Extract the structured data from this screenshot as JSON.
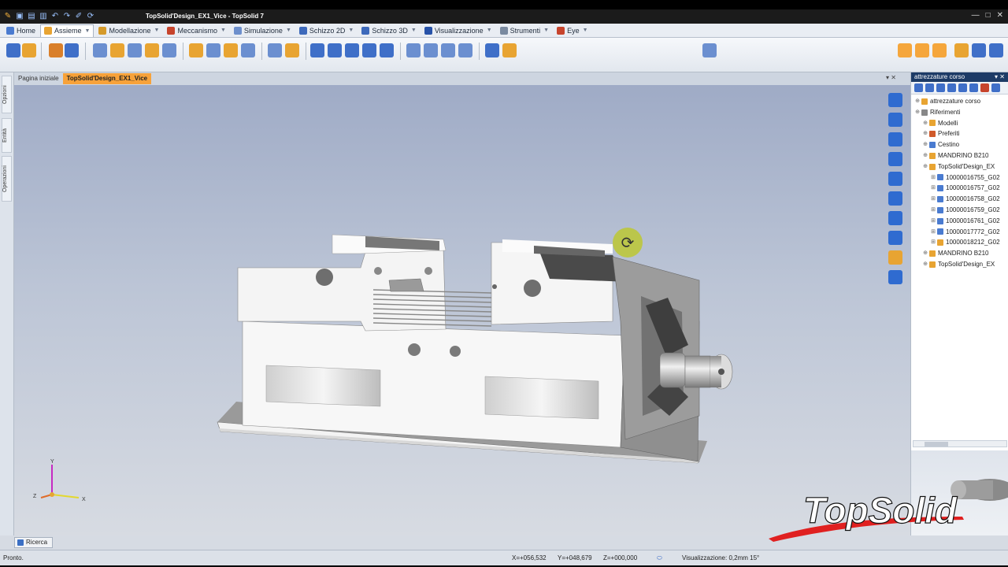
{
  "window": {
    "title": "TopSolid'Design_EX1_Vice - TopSolid 7"
  },
  "ribbon_tabs": [
    "Home",
    "Assieme",
    "Modellazione",
    "Meccanismo",
    "Simulazione",
    "Schizzo 2D",
    "Schizzo 3D",
    "Visualizzazione",
    "Strumenti",
    "Eye"
  ],
  "doc_tabs": {
    "home": "Pagina iniziale",
    "active": "TopSolid'Design_EX1_Vice"
  },
  "left_tabs": [
    "Opzioni",
    "Entità",
    "Operazioni"
  ],
  "tree": {
    "header": "attrezzature corso",
    "nodes": [
      {
        "label": "attrezzature corso",
        "indent": 0,
        "color": "#e8a432"
      },
      {
        "label": "Riferimenti",
        "indent": 0,
        "color": "#888"
      },
      {
        "label": "Modelli",
        "indent": 1,
        "color": "#e8a432"
      },
      {
        "label": "Preferiti",
        "indent": 1,
        "color": "#d05a2a"
      },
      {
        "label": "Cestino",
        "indent": 1,
        "color": "#4a7bd0"
      },
      {
        "label": "MANDRINO B210",
        "indent": 1,
        "color": "#e8a432"
      },
      {
        "label": "TopSolid'Design_EX",
        "indent": 1,
        "color": "#e8a432"
      },
      {
        "label": "10000016755_G02",
        "indent": 2,
        "color": "#4a7bd0"
      },
      {
        "label": "10000016757_G02",
        "indent": 2,
        "color": "#4a7bd0"
      },
      {
        "label": "10000016758_G02",
        "indent": 2,
        "color": "#4a7bd0"
      },
      {
        "label": "10000016759_G02",
        "indent": 2,
        "color": "#4a7bd0"
      },
      {
        "label": "10000016761_G02",
        "indent": 2,
        "color": "#4a7bd0"
      },
      {
        "label": "10000017772_G02",
        "indent": 2,
        "color": "#4a7bd0"
      },
      {
        "label": "10000018212_G02",
        "indent": 2,
        "color": "#e8a432"
      },
      {
        "label": "MANDRINO B210",
        "indent": 1,
        "color": "#e8a432"
      },
      {
        "label": "TopSolid'Design_EX",
        "indent": 1,
        "color": "#e8a432"
      }
    ]
  },
  "search_tab": "Ricerca",
  "status": {
    "ready": "Pronto.",
    "x": "X=+056,532",
    "y": "Y=+048,679",
    "z": "Z=+000,000",
    "view": "Visualizzazione: 0,2mm 15°"
  },
  "triad": {
    "y": "Y",
    "x": "X",
    "z": "Z"
  },
  "logo": {
    "text": "TopSolid"
  },
  "colors": {
    "accent": "#f7a23a",
    "tree_header": "#1d3b66",
    "logo_red": "#e02020"
  }
}
